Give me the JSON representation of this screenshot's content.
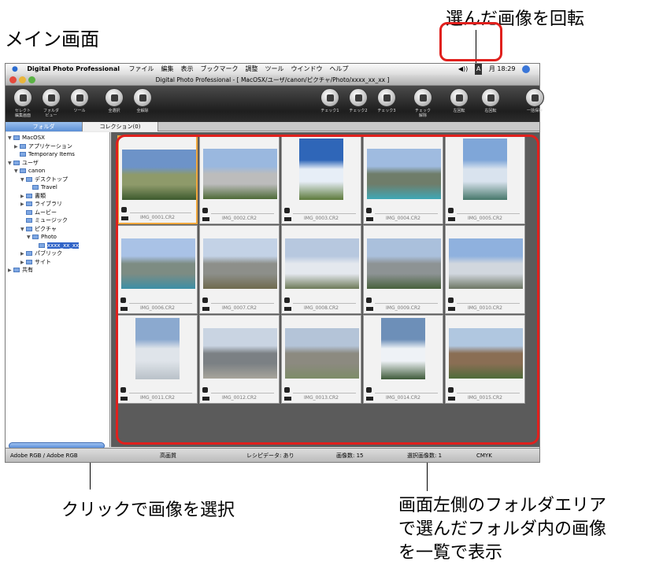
{
  "annotations": {
    "title": "メイン画面",
    "rotate": "選んだ画像を回転",
    "click": "クリックで画像を選択",
    "list": [
      "画面左側のフォルダエリア",
      "で選んだフォルダ内の画像",
      "を一覧で表示"
    ]
  },
  "menubar": {
    "app_name": "Digital Photo Professional",
    "items": [
      "ファイル",
      "編集",
      "表示",
      "ブックマーク",
      "調整",
      "ツール",
      "ウインドウ",
      "ヘルプ"
    ],
    "clock": "月 18:29",
    "input_mode": "A"
  },
  "window": {
    "title": "Digital Photo Professional - [ MacOSX/ユーザ/canon/ピクチャ/Photo/xxxx_xx_xx ]"
  },
  "toolbar": {
    "buttons": [
      "セレクト\n編集画面",
      "フォルダ\nビュー",
      "ツール",
      "全選択",
      "全解除",
      "チェック1",
      "チェック2",
      "チェック3",
      "チェック\n解除",
      "左回転",
      "右回転",
      "一括保存"
    ]
  },
  "tabs": {
    "folder": "フォルダ",
    "collection": "コレクション(0)"
  },
  "tree": [
    "MacOSX",
    "アプリケーション",
    "Temporary Items",
    "ユーザ",
    "canon",
    "デスクトップ",
    "Travel",
    "書類",
    "ライブラリ",
    "ムービー",
    "ミュージック",
    "ピクチャ",
    "Photo",
    "xxxx_xx_xx",
    "パブリック",
    "サイト",
    "共有"
  ],
  "images": [
    "IMG_0001.CR2",
    "IMG_0002.CR2",
    "IMG_0003.CR2",
    "IMG_0004.CR2",
    "IMG_0005.CR2",
    "IMG_0006.CR2",
    "IMG_0007.CR2",
    "IMG_0008.CR2",
    "IMG_0009.CR2",
    "IMG_0010.CR2",
    "IMG_0011.CR2",
    "IMG_0012.CR2",
    "IMG_0013.CR2",
    "IMG_0014.CR2",
    "IMG_0015.CR2"
  ],
  "status": {
    "color_space": "Adobe RGB / Adobe RGB",
    "quality": "高画質",
    "recipe": "レシピデータ: あり",
    "count": "画像数: 15",
    "selected": "選択画像数: 1",
    "cmyk": "CMYK"
  },
  "colors": {
    "highlight": "#e0201d",
    "selection": "#f0a73c",
    "grid_bg": "#5b5b5b"
  }
}
